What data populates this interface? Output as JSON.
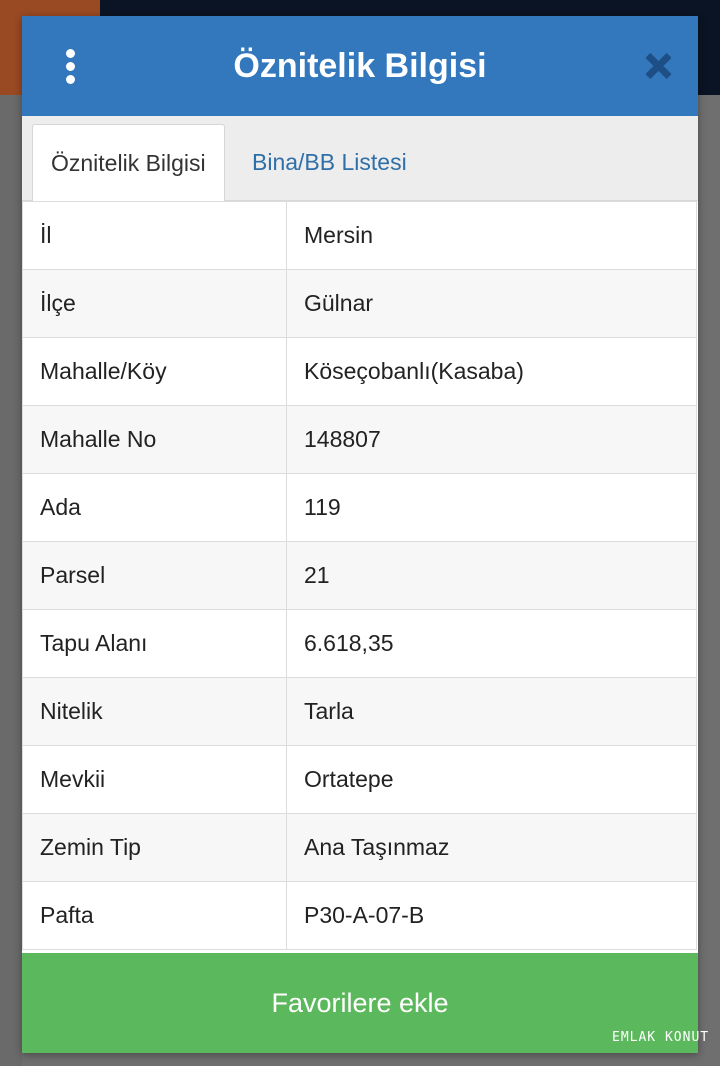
{
  "dialog": {
    "title": "Öznitelik Bilgisi",
    "menu_icon": "vertical-dots-icon",
    "close_icon": "close-icon"
  },
  "tabs": [
    {
      "label": "Öznitelik Bilgisi",
      "active": true
    },
    {
      "label": "Bina/BB Listesi",
      "active": false
    }
  ],
  "attributes": [
    {
      "key": "İl",
      "value": "Mersin"
    },
    {
      "key": "İlçe",
      "value": "Gülnar"
    },
    {
      "key": "Mahalle/Köy",
      "value": "Köseçobanlı(Kasaba)"
    },
    {
      "key": "Mahalle No",
      "value": "148807"
    },
    {
      "key": "Ada",
      "value": "119"
    },
    {
      "key": "Parsel",
      "value": "21"
    },
    {
      "key": "Tapu Alanı",
      "value": "6.618,35"
    },
    {
      "key": "Nitelik",
      "value": "Tarla"
    },
    {
      "key": "Mevkii",
      "value": "Ortatepe"
    },
    {
      "key": "Zemin Tip",
      "value": "Ana Taşınmaz"
    },
    {
      "key": "Pafta",
      "value": "P30-A-07-B"
    }
  ],
  "footer": {
    "favorite_label": "Favorilere ekle"
  },
  "watermark": "EMLAK KONUT",
  "colors": {
    "header": "#3377bd",
    "favorite_button": "#5cb85c",
    "tab_link": "#2f6fa8"
  }
}
